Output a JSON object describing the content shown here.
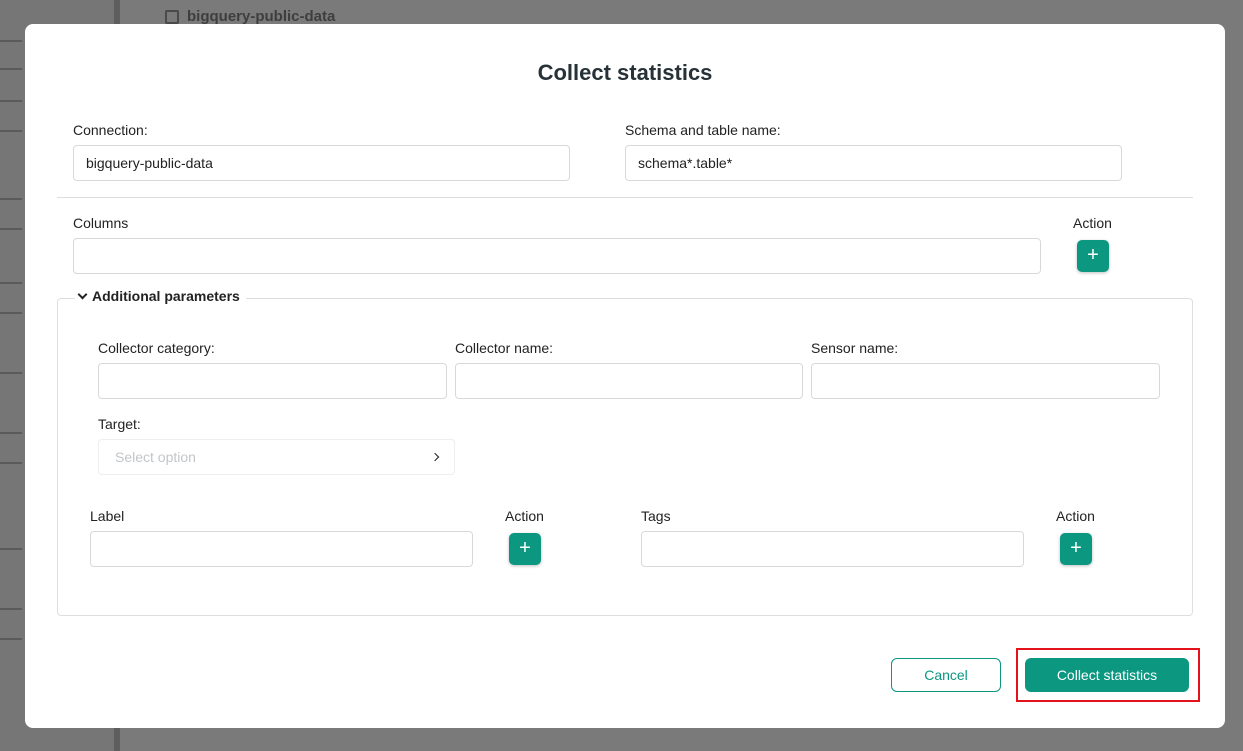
{
  "background": {
    "breadcrumb": "bigquery-public-data"
  },
  "modal": {
    "title": "Collect statistics",
    "connection": {
      "label": "Connection:",
      "value": "bigquery-public-data"
    },
    "schema_table": {
      "label": "Schema and table name:",
      "value": "schema*.table*"
    },
    "columns": {
      "label": "Columns",
      "value": "",
      "action_label": "Action"
    },
    "additional": {
      "title": "Additional parameters",
      "collector_category": {
        "label": "Collector category:",
        "value": ""
      },
      "collector_name": {
        "label": "Collector name:",
        "value": ""
      },
      "sensor_name": {
        "label": "Sensor name:",
        "value": ""
      },
      "target": {
        "label": "Target:",
        "placeholder": "Select option"
      },
      "label_field": {
        "label": "Label",
        "value": "",
        "action_label": "Action"
      },
      "tags_field": {
        "label": "Tags",
        "value": "",
        "action_label": "Action"
      }
    },
    "buttons": {
      "cancel": "Cancel",
      "collect": "Collect statistics"
    }
  },
  "colors": {
    "primary": "#0b9780",
    "highlight": "#e3121b"
  },
  "icons": {
    "add": "+"
  }
}
